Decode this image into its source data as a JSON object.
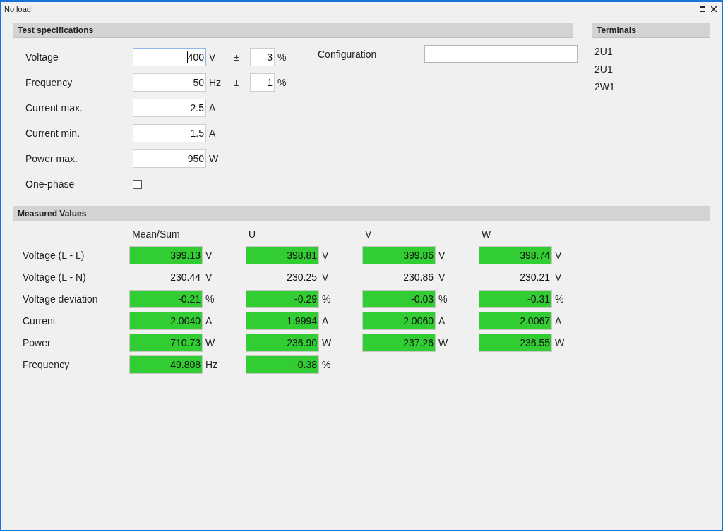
{
  "window": {
    "title": "No load"
  },
  "test_specifications": {
    "title": "Test specifications",
    "rows": [
      {
        "label": "Voltage",
        "value": "400",
        "unit": "V",
        "focused": true,
        "tolerance": {
          "sign": "±",
          "value": "3",
          "unit": "%"
        }
      },
      {
        "label": "Frequency",
        "value": "50",
        "unit": "Hz",
        "focused": false,
        "tolerance": {
          "sign": "±",
          "value": "1",
          "unit": "%"
        }
      },
      {
        "label": "Current max.",
        "value": "2.5",
        "unit": "A",
        "focused": false
      },
      {
        "label": "Current min.",
        "value": "1.5",
        "unit": "A",
        "focused": false
      },
      {
        "label": "Power max.",
        "value": "950",
        "unit": "W",
        "focused": false
      }
    ],
    "one_phase": {
      "label": "One-phase",
      "checked": false
    },
    "configuration": {
      "label": "Configuration"
    }
  },
  "terminals": {
    "title": "Terminals",
    "items": [
      "2U1",
      "2U1",
      "2W1"
    ]
  },
  "measured_values": {
    "title": "Measured Values",
    "columns": [
      "Mean/Sum",
      "U",
      "V",
      "W"
    ],
    "rows": [
      {
        "label": "Voltage (L - L)",
        "cells": [
          {
            "value": "399.13",
            "unit": "V",
            "highlighted": true
          },
          {
            "value": "398.81",
            "unit": "V",
            "highlighted": true
          },
          {
            "value": "399.86",
            "unit": "V",
            "highlighted": true
          },
          {
            "value": "398.74",
            "unit": "V",
            "highlighted": true
          }
        ]
      },
      {
        "label": "Voltage (L - N)",
        "cells": [
          {
            "value": "230.44",
            "unit": "V",
            "highlighted": false
          },
          {
            "value": "230.25",
            "unit": "V",
            "highlighted": false
          },
          {
            "value": "230.86",
            "unit": "V",
            "highlighted": false
          },
          {
            "value": "230.21",
            "unit": "V",
            "highlighted": false
          }
        ]
      },
      {
        "label": "Voltage deviation",
        "cells": [
          {
            "value": "-0.21",
            "unit": "%",
            "highlighted": true
          },
          {
            "value": "-0.29",
            "unit": "%",
            "highlighted": true
          },
          {
            "value": "-0.03",
            "unit": "%",
            "highlighted": true
          },
          {
            "value": "-0.31",
            "unit": "%",
            "highlighted": true
          }
        ]
      },
      {
        "label": "Current",
        "cells": [
          {
            "value": "2.0040",
            "unit": "A",
            "highlighted": true
          },
          {
            "value": "1.9994",
            "unit": "A",
            "highlighted": true
          },
          {
            "value": "2.0060",
            "unit": "A",
            "highlighted": true
          },
          {
            "value": "2.0067",
            "unit": "A",
            "highlighted": true
          }
        ]
      },
      {
        "label": "Power",
        "cells": [
          {
            "value": "710.73",
            "unit": "W",
            "highlighted": true
          },
          {
            "value": "236.90",
            "unit": "W",
            "highlighted": true
          },
          {
            "value": "237.26",
            "unit": "W",
            "highlighted": true
          },
          {
            "value": "236.55",
            "unit": "W",
            "highlighted": true
          }
        ]
      },
      {
        "label": "Frequency",
        "cells": [
          {
            "value": "49.808",
            "unit": "Hz",
            "highlighted": true
          },
          {
            "value": "-0.38",
            "unit": "%",
            "highlighted": true
          }
        ]
      }
    ]
  }
}
